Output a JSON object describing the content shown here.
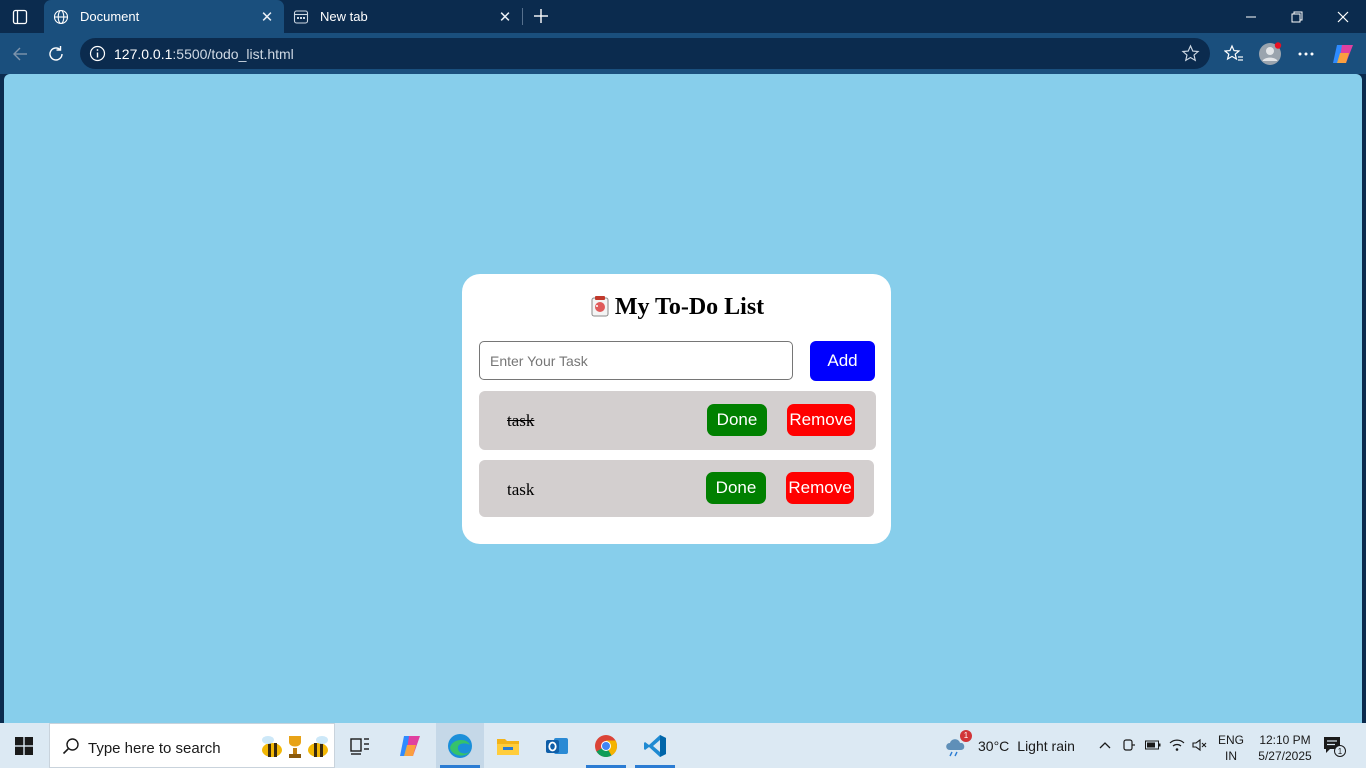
{
  "browser": {
    "tabs": [
      {
        "label": "Document",
        "active": true
      },
      {
        "label": "New tab",
        "active": false
      }
    ],
    "address": {
      "host": "127.0.0.1",
      "rest": ":5500/todo_list.html"
    }
  },
  "todo": {
    "title": "My To-Do List",
    "input_placeholder": "Enter Your Task",
    "add_label": "Add",
    "tasks": [
      {
        "text": "task",
        "completed": true,
        "done_label": "Done",
        "remove_label": "Remove"
      },
      {
        "text": "task",
        "completed": false,
        "done_label": "Done",
        "remove_label": "Remove"
      }
    ],
    "colors": {
      "background": "#87ceeb",
      "add": "#0000ff",
      "done": "#008000",
      "remove": "#ff0000",
      "row": "#d3cfcf"
    }
  },
  "taskbar": {
    "search_placeholder": "Type here to search",
    "weather": {
      "temp": "30°C",
      "condition": "Light rain",
      "alerts": "1"
    },
    "language": {
      "line1": "ENG",
      "line2": "IN"
    },
    "clock": {
      "time": "12:10 PM",
      "date": "5/27/2025"
    },
    "notification_count": "1",
    "apps": [
      "task-view-icon",
      "copilot-icon",
      "edge-icon",
      "file-explorer-icon",
      "outlook-icon",
      "chrome-icon",
      "vscode-icon"
    ]
  }
}
